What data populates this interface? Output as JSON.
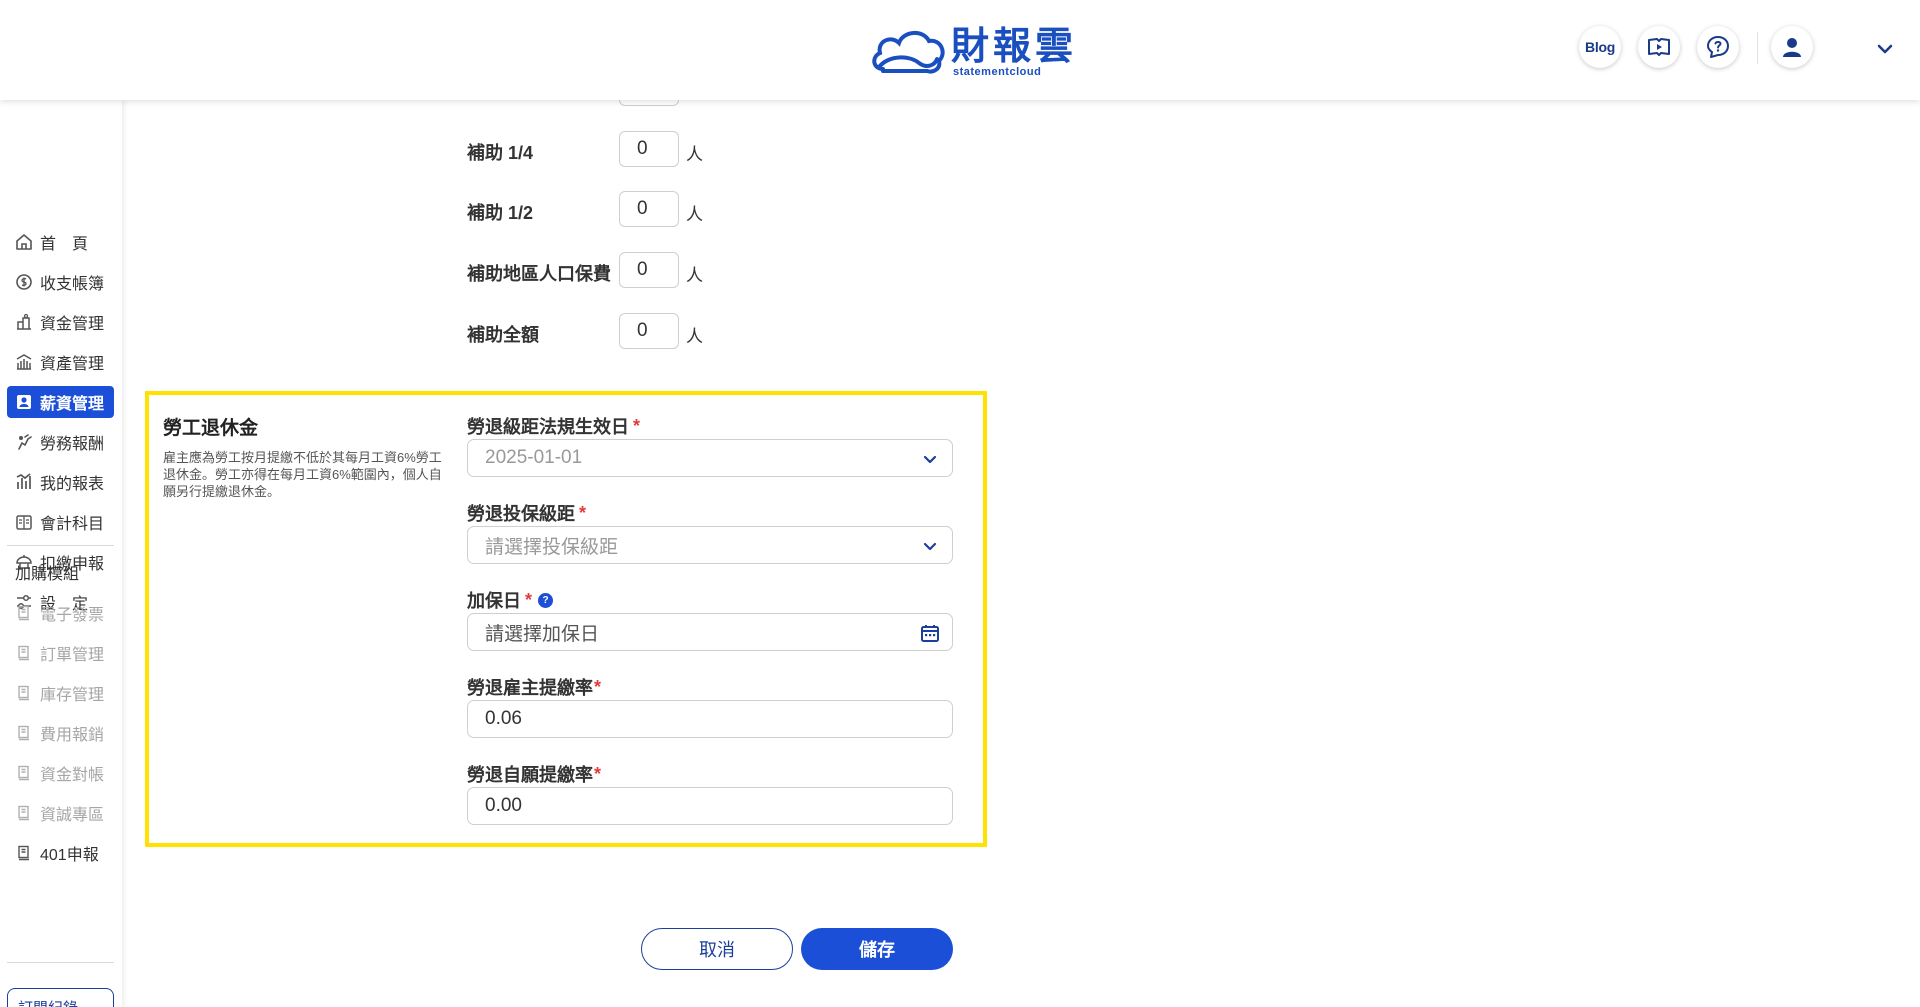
{
  "header": {
    "logo_zh": "財報雲",
    "logo_en": "statementcloud",
    "blog_label": "Blog",
    "icons": [
      "book-video-icon",
      "chat-help-icon",
      "user-icon",
      "chevron-down-icon"
    ]
  },
  "sidebar": {
    "items": [
      {
        "label": "首　頁",
        "icon": "home-icon"
      },
      {
        "label": "收支帳簿",
        "icon": "coin-icon"
      },
      {
        "label": "資金管理",
        "icon": "funds-icon"
      },
      {
        "label": "資產管理",
        "icon": "asset-icon"
      },
      {
        "label": "薪資管理",
        "icon": "payroll-icon",
        "active": true
      },
      {
        "label": "勞務報酬",
        "icon": "service-icon"
      },
      {
        "label": "我的報表",
        "icon": "report-icon"
      },
      {
        "label": "會計科目",
        "icon": "ledger-icon"
      },
      {
        "label": "扣繳申報",
        "icon": "tax-icon"
      },
      {
        "label": "設　定",
        "icon": "settings-icon"
      }
    ],
    "addon_heading": "加購模組",
    "addons": [
      {
        "label": "電子發票",
        "enabled": false
      },
      {
        "label": "訂單管理",
        "enabled": false
      },
      {
        "label": "庫存管理",
        "enabled": false
      },
      {
        "label": "費用報銷",
        "enabled": false
      },
      {
        "label": "資金對帳",
        "enabled": false
      },
      {
        "label": "資誠專區",
        "enabled": false
      },
      {
        "label": "401申報",
        "enabled": true
      }
    ],
    "subscription_label": "訂閱紀錄"
  },
  "subsidy": {
    "rows": [
      {
        "label": "補助 1/4",
        "value": "0",
        "unit": "人"
      },
      {
        "label": "補助 1/2",
        "value": "0",
        "unit": "人"
      },
      {
        "label": "補助地區人口保費",
        "value": "0",
        "unit": "人"
      },
      {
        "label": "補助全額",
        "value": "0",
        "unit": "人"
      }
    ]
  },
  "pension": {
    "title": "勞工退休金",
    "description": "雇主應為勞工按月提繳不低於其每月工資6%勞工退休金。勞工亦得在每月工資6%範圍內，個人自願另行提繳退休金。",
    "fields": {
      "effective_date": {
        "label": "勞退級距法規生效日",
        "value": "2025-01-01"
      },
      "bracket": {
        "label": "勞退投保級距",
        "placeholder": "請選擇投保級距"
      },
      "enroll_date": {
        "label": "加保日",
        "placeholder": "請選擇加保日"
      },
      "employer_rate": {
        "label": "勞退雇主提繳率",
        "value": "0.06"
      },
      "voluntary_rate": {
        "label": "勞退自願提繳率",
        "value": "0.00"
      }
    },
    "required_mark": "*",
    "help_mark": "?"
  },
  "actions": {
    "cancel_label": "取消",
    "save_label": "儲存"
  },
  "colors": {
    "primary": "#1c4fd8",
    "highlight": "#ffe200",
    "required": "#e23b3b"
  }
}
